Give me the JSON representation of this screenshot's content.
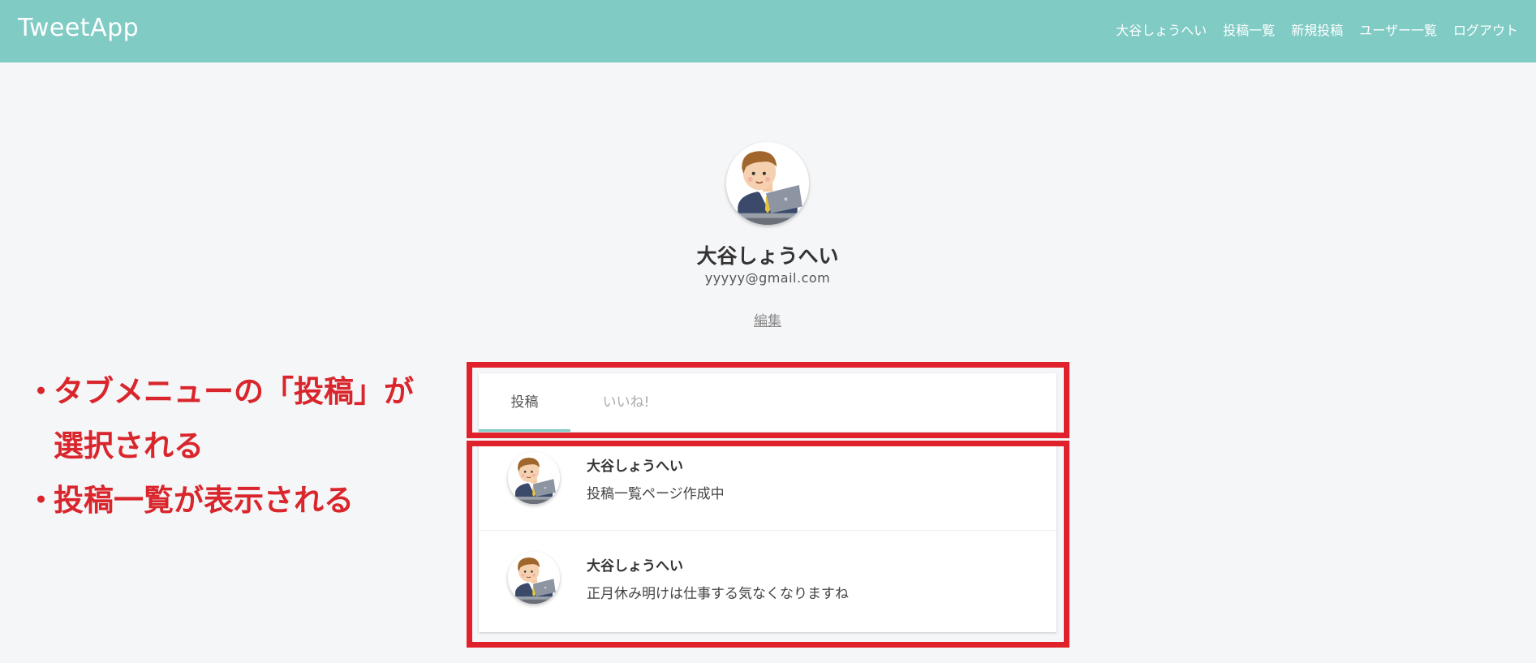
{
  "header": {
    "logo": "TweetApp",
    "bg_color": "#80cbc4",
    "nav": [
      {
        "label": "大谷しょうへい"
      },
      {
        "label": "投稿一覧"
      },
      {
        "label": "新規投稿"
      },
      {
        "label": "ユーザー一覧"
      },
      {
        "label": "ログアウト"
      }
    ]
  },
  "profile": {
    "name": "大谷しょうへい",
    "email": "yyyyy@gmail.com",
    "edit_label": "編集",
    "avatar_icon": "businessman-laptop-avatar"
  },
  "tabs": [
    {
      "label": "投稿",
      "active": true
    },
    {
      "label": "いいね!",
      "active": false
    }
  ],
  "posts": [
    {
      "user": "大谷しょうへい",
      "text": "投稿一覧ページ作成中"
    },
    {
      "user": "大谷しょうへい",
      "text": "正月休み明けは仕事する気なくなりますね"
    }
  ],
  "annotations": {
    "bullet": "・",
    "line1": "タブメニューの「投稿」が",
    "line2": "選択される",
    "line3": "投稿一覧が表示される",
    "color": "#e0202a"
  }
}
